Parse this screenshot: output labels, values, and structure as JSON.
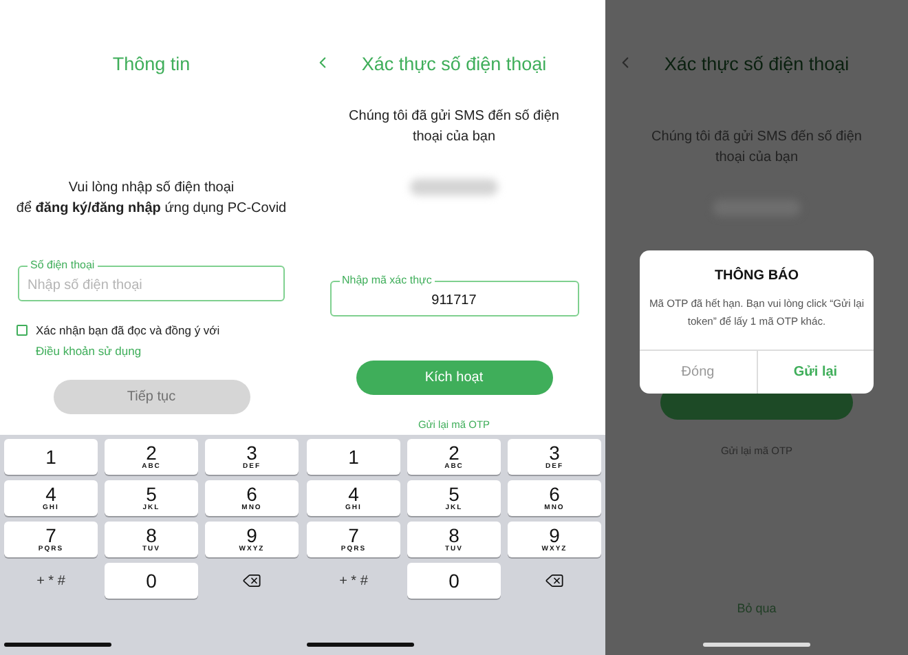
{
  "info_screen": {
    "title": "Thông tin",
    "prompt_lines": [
      "Vui lòng nhập số điện thoại",
      "để **đăng ký/đăng nhập** ứng dụng PC-Covid"
    ],
    "phone_field": {
      "label": "Số điện thoại",
      "placeholder": "Nhập số điện thoại"
    },
    "consent": {
      "checked": false,
      "text": "Xác nhận bạn đã đọc và đồng ý với",
      "link": "Điều khoản sử dụng"
    },
    "continue_button": {
      "label": "Tiếp tục",
      "disabled": true
    },
    "keypad": [
      {
        "kind": "digit",
        "digit": "1"
      },
      {
        "kind": "digit",
        "digit": "2",
        "letters": "ABC"
      },
      {
        "kind": "digit",
        "digit": "3",
        "letters": "DEF"
      },
      {
        "kind": "digit",
        "digit": "4",
        "letters": "GHI"
      },
      {
        "kind": "digit",
        "digit": "5",
        "letters": "JKL"
      },
      {
        "kind": "digit",
        "digit": "6",
        "letters": "MNO"
      },
      {
        "kind": "digit",
        "digit": "7",
        "letters": "PQRS"
      },
      {
        "kind": "digit",
        "digit": "8",
        "letters": "TUV"
      },
      {
        "kind": "digit",
        "digit": "9",
        "letters": "WXYZ"
      },
      {
        "kind": "symbols",
        "label": "+ * #"
      },
      {
        "kind": "digit",
        "digit": "0"
      },
      {
        "kind": "backspace"
      }
    ]
  },
  "verify_screen": {
    "title": "Xác thực số điện thoại",
    "message": "Chúng tôi đã gửi SMS đến số điện thoại của bạn",
    "code_field": {
      "label": "Nhập mã xác thực",
      "value": "911717"
    },
    "activate_button": {
      "label": "Kích hoạt",
      "disabled": false
    },
    "resend_link": "Gửi lại mã OTP",
    "keypad": [
      {
        "kind": "digit",
        "digit": "1"
      },
      {
        "kind": "digit",
        "digit": "2",
        "letters": "ABC"
      },
      {
        "kind": "digit",
        "digit": "3",
        "letters": "DEF"
      },
      {
        "kind": "digit",
        "digit": "4",
        "letters": "GHI"
      },
      {
        "kind": "digit",
        "digit": "5",
        "letters": "JKL"
      },
      {
        "kind": "digit",
        "digit": "6",
        "letters": "MNO"
      },
      {
        "kind": "digit",
        "digit": "7",
        "letters": "PQRS"
      },
      {
        "kind": "digit",
        "digit": "8",
        "letters": "TUV"
      },
      {
        "kind": "digit",
        "digit": "9",
        "letters": "WXYZ"
      },
      {
        "kind": "symbols",
        "label": "+ * #"
      },
      {
        "kind": "digit",
        "digit": "0"
      },
      {
        "kind": "backspace"
      }
    ]
  },
  "alert_screen": {
    "title": "Xác thực số điện thoại",
    "message": "Chúng tôi đã gửi SMS đến số điện thoại của bạn",
    "resend_link": "Gửi lại mã OTP",
    "skip_link": "Bỏ qua",
    "dialog": {
      "title": "THÔNG BÁO",
      "message": "Mã OTP đã hết hạn. Bạn vui lòng click “Gửi lại token” để lấy 1 mã OTP khác.",
      "buttons": [
        {
          "label": "Đóng",
          "kind": "cancel"
        },
        {
          "label": "Gửi lại",
          "kind": "confirm"
        }
      ]
    }
  }
}
